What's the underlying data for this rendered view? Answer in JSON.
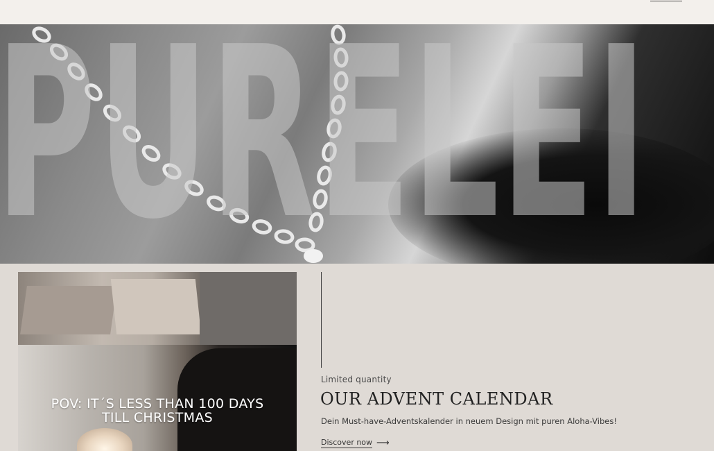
{
  "hero": {
    "brand_text": "PURELEI",
    "image_description": "chain-necklace-photo"
  },
  "video": {
    "caption_line1": "POV: IT´S LESS THAN 100 DAYS",
    "caption_line2": "TILL CHRISTMAS"
  },
  "promo": {
    "eyebrow": "Limited quantity",
    "title": "OUR ADVENT CALENDAR",
    "description": "Dein Must-have-Adventskalender in neuem Design mit puren Aloha-Vibes!",
    "cta_label": "Discover now",
    "cta_arrow": "⟶"
  },
  "colors": {
    "page_bg": "#dfdad5",
    "topbar_bg": "#f3f0ec",
    "text_dark": "#222222"
  }
}
